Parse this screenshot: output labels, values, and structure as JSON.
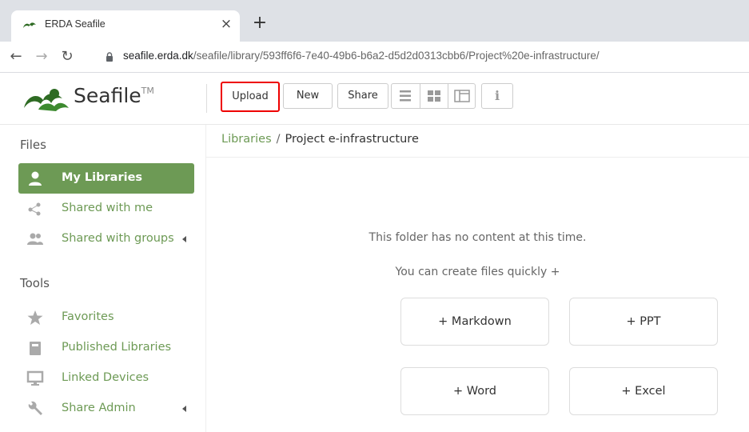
{
  "browser": {
    "tab_title": "ERDA Seafile",
    "tab_close": "×",
    "new_tab": "+",
    "url_host": "seafile.erda.dk",
    "url_path": "/seafile/library/593ff6f6-7e40-49b6-b6a2-d5d2d0313cbb6/Project%20e-infrastructure/"
  },
  "header": {
    "logo_text": "Seafile",
    "logo_tm": "TM",
    "upload_label": "Upload",
    "new_label": "New",
    "share_label": "Share",
    "info_label": "i"
  },
  "sidebar": {
    "files_heading": "Files",
    "tools_heading": "Tools",
    "files_items": [
      {
        "label": "My Libraries",
        "icon": "user-icon",
        "active": true
      },
      {
        "label": "Shared with me",
        "icon": "share-nodes-icon"
      },
      {
        "label": "Shared with groups",
        "icon": "group-icon"
      }
    ],
    "tools_items": [
      {
        "label": "Favorites",
        "icon": "star-icon"
      },
      {
        "label": "Published Libraries",
        "icon": "book-icon"
      },
      {
        "label": "Linked Devices",
        "icon": "monitor-icon"
      },
      {
        "label": "Share Admin",
        "icon": "wrench-icon"
      }
    ]
  },
  "main": {
    "breadcrumb_root": "Libraries",
    "breadcrumb_sep": "/",
    "breadcrumb_current": "Project e-infrastructure",
    "empty_message": "This folder has no content at this time.",
    "create_hint": "You can create files quickly +",
    "create_buttons": [
      "+ Markdown",
      "+ PPT",
      "+ Word",
      "+ Excel"
    ]
  },
  "colors": {
    "accent": "#6d9a55",
    "highlight_border": "#ee0000"
  }
}
